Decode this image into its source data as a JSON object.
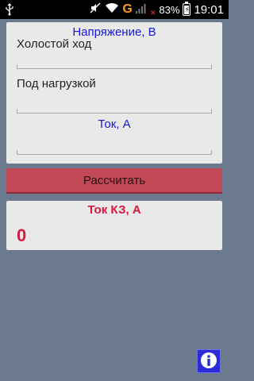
{
  "status_bar": {
    "network_type": "G",
    "battery_percent": "83%",
    "time": "19:01"
  },
  "voltage_section": {
    "title": "Напряжение, В",
    "no_load_label": "Холостой ход",
    "no_load_value": "",
    "under_load_label": "Под нагрузкой",
    "under_load_value": ""
  },
  "current_section": {
    "title": "Ток, А",
    "current_value": ""
  },
  "calculate_button": {
    "label": "Рассчитать"
  },
  "result": {
    "title": "Ток КЗ, А",
    "value": "0"
  },
  "colors": {
    "background": "#6b7a8f",
    "title_blue": "#1717e0",
    "button_red": "#c24856",
    "result_red": "#d6193c"
  },
  "icons": [
    "usb-icon",
    "mute-icon",
    "wifi-icon",
    "signal-icon",
    "battery-icon",
    "info-icon"
  ]
}
